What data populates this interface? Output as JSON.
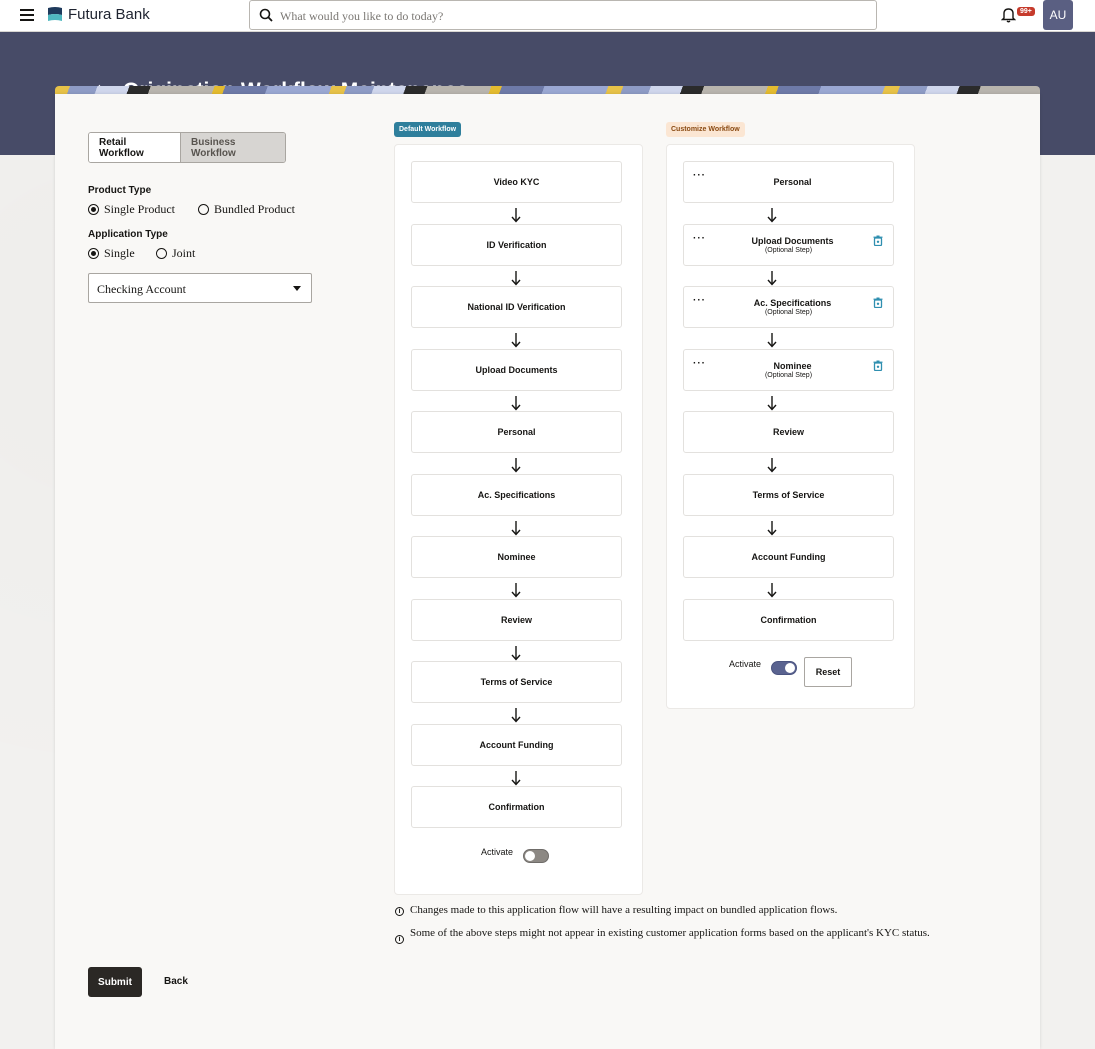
{
  "topbar": {
    "brand": "Futura Bank",
    "search_placeholder": "What would you like to do today?",
    "notification_badge": "99+",
    "avatar_initials": "AU",
    "icons": [
      "hamburger-menu-icon",
      "bank-logo-icon",
      "search-icon",
      "bell-icon"
    ]
  },
  "header": {
    "back_icon": "up-arrow-icon",
    "title": "Origination Workflow Maintenance"
  },
  "filters": {
    "workflow_tabs": [
      {
        "label": "Retail Workflow",
        "active": true
      },
      {
        "label": "Business Workflow",
        "active": false
      }
    ],
    "product_type": {
      "label": "Product Type",
      "options": [
        {
          "label": "Single Product",
          "selected": true
        },
        {
          "label": "Bundled Product",
          "selected": false
        }
      ]
    },
    "application_type": {
      "label": "Application Type",
      "options": [
        {
          "label": "Single",
          "selected": true
        },
        {
          "label": "Joint",
          "selected": false
        }
      ]
    },
    "product_select": {
      "value": "Checking Account"
    }
  },
  "default_workflow": {
    "tag": "Default Workflow",
    "steps": [
      "Video KYC",
      "ID Verification",
      "National ID Verification",
      "Upload Documents",
      "Personal",
      "Ac. Specifications",
      "Nominee",
      "Review",
      "Terms of Service",
      "Account Funding",
      "Confirmation"
    ],
    "activate_label": "Activate",
    "activate_on": false
  },
  "custom_workflow": {
    "tag": "Customize Workflow",
    "steps": [
      {
        "name": "Personal",
        "optional_text": "",
        "draggable": true,
        "deletable": false
      },
      {
        "name": "Upload Documents",
        "optional_text": "(Optional Step)",
        "draggable": true,
        "deletable": true
      },
      {
        "name": "Ac. Specifications",
        "optional_text": "(Optional Step)",
        "draggable": true,
        "deletable": true
      },
      {
        "name": "Nominee",
        "optional_text": "(Optional Step)",
        "draggable": true,
        "deletable": true
      },
      {
        "name": "Review",
        "optional_text": "",
        "draggable": false,
        "deletable": false
      },
      {
        "name": "Terms of Service",
        "optional_text": "",
        "draggable": false,
        "deletable": false
      },
      {
        "name": "Account Funding",
        "optional_text": "",
        "draggable": false,
        "deletable": false
      },
      {
        "name": "Confirmation",
        "optional_text": "",
        "draggable": false,
        "deletable": false
      }
    ],
    "activate_label": "Activate",
    "activate_on": true,
    "reset_label": "Reset"
  },
  "notes": [
    "Changes made to this application flow will have a resulting impact on bundled application flows.",
    "Some of the above steps might not appear in existing customer application forms based on the applicant's KYC status."
  ],
  "actions": {
    "submit_label": "Submit",
    "back_label": "Back"
  },
  "colors": {
    "header_band": "#474b67",
    "default_tag": "#2f7f9c",
    "custom_tag_bg": "#fbe6d3",
    "toggle_on": "#5a6390",
    "submit_bg": "#2b2825",
    "badge": "#c63b2c"
  }
}
